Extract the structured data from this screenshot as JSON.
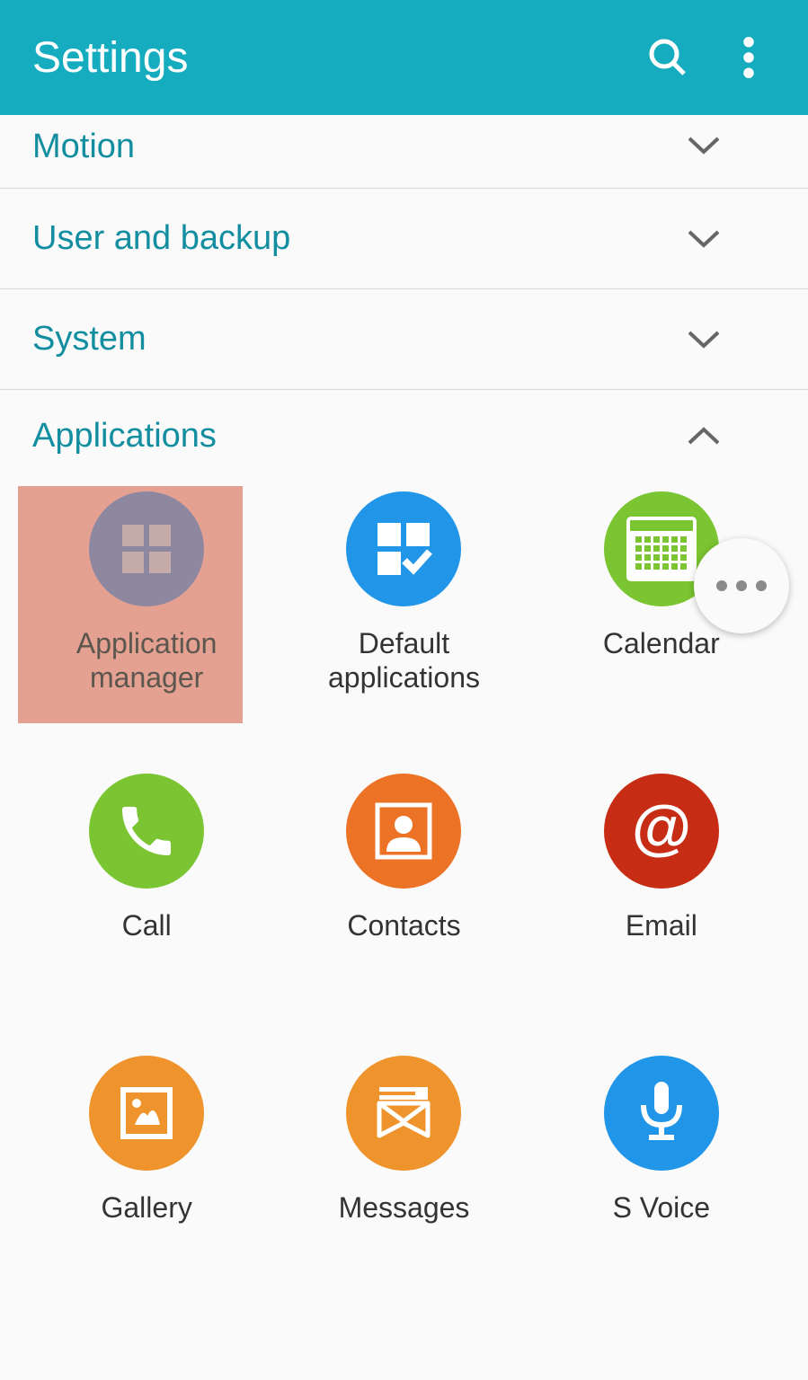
{
  "header": {
    "title": "Settings"
  },
  "sections": {
    "motion": "Motion",
    "userbackup": "User and backup",
    "system": "System",
    "applications": "Applications"
  },
  "apps": {
    "appmanager": "Application manager",
    "defaultapps": "Default applications",
    "calendar": "Calendar",
    "call": "Call",
    "contacts": "Contacts",
    "email": "Email",
    "gallery": "Gallery",
    "messages": "Messages",
    "svoice": "S Voice"
  }
}
